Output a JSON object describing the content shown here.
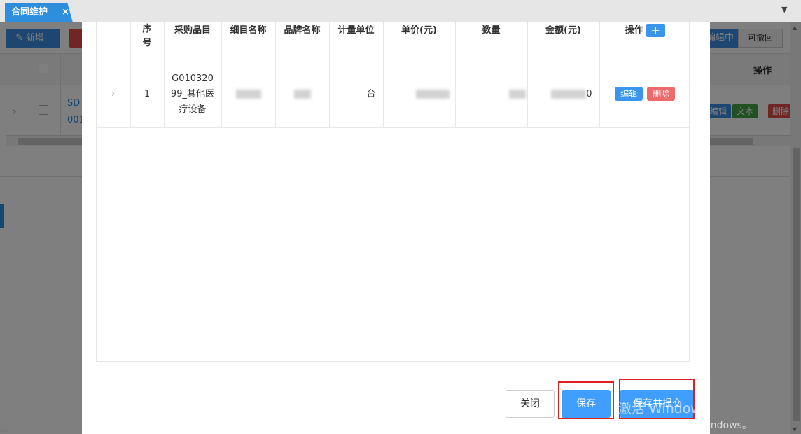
{
  "tab": {
    "title": "合同维护",
    "close": "×"
  },
  "background": {
    "new_label": "新增",
    "editing_label": "编辑中",
    "revoke_label": "可撤回",
    "op_header": "操作",
    "row_code_line1": "SD",
    "row_code_line2": "001",
    "tag_edit": "编辑",
    "tag_text": "文本",
    "tag_delete": "删除",
    "bottom_text": "..."
  },
  "grid": {
    "headers": {
      "seq": "序号",
      "category": "采购品目",
      "item_name": "细目名称",
      "brand": "品牌名称",
      "unit": "计量单位",
      "unit_price": "单价(元)",
      "quantity": "数量",
      "amount": "金额(元)",
      "ops": "操作",
      "add": "+"
    },
    "rows": [
      {
        "seq": "1",
        "category": "G01032099_其他医疗设备",
        "unit": "台",
        "amount_tail": "0",
        "edit": "编辑",
        "delete": "删除"
      }
    ]
  },
  "footer": {
    "close_label": "关闭",
    "save_label": "保存",
    "submit_label": "保存并提交"
  },
  "watermark": {
    "line1": "激活 Windows",
    "line2": "转到\"设置\"以激活 Windows。"
  },
  "colors": {
    "primary": "#409eff",
    "tab": "#2e8ede",
    "danger": "#ef6b6b",
    "highlight": "#e02020"
  }
}
